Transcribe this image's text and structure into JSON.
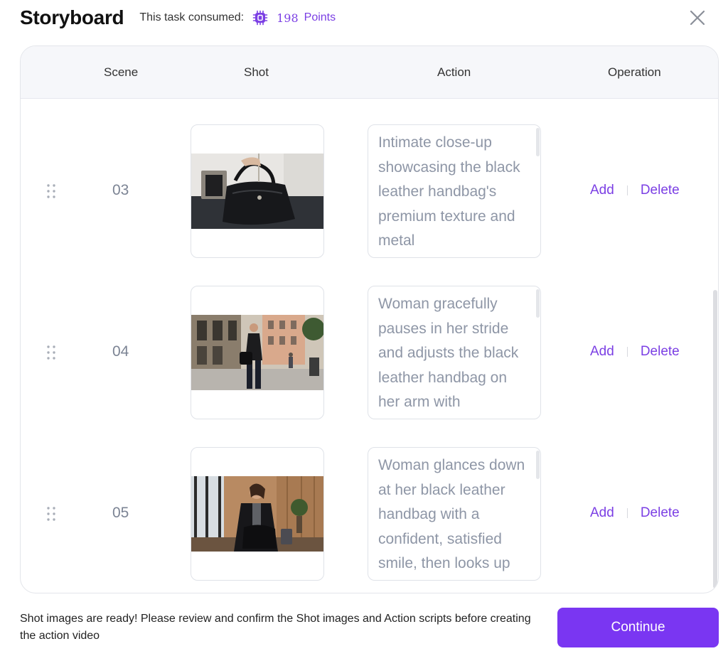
{
  "header": {
    "title": "Storyboard",
    "consumed_label": "This task consumed:",
    "points_value": "198",
    "points_unit": "Points"
  },
  "table": {
    "columns": {
      "scene": "Scene",
      "shot": "Shot",
      "action": "Action",
      "operation": "Operation"
    },
    "rows": [
      {
        "scene": "03",
        "action": "Intimate close-up showcasing the black leather handbag's premium texture and metal",
        "add": "Add",
        "delete": "Delete"
      },
      {
        "scene": "04",
        "action": "Woman gracefully pauses in her stride and adjusts the black leather handbag on her arm with",
        "add": "Add",
        "delete": "Delete"
      },
      {
        "scene": "05",
        "action": "Woman glances down at her black leather handbag with a confident, satisfied smile, then looks up",
        "add": "Add",
        "delete": "Delete"
      }
    ]
  },
  "footer": {
    "message": "Shot images are ready! Please review and confirm the Shot images and Action scripts before creating the action video",
    "continue_label": "Continue"
  },
  "colors": {
    "accent": "#7a36f2",
    "link": "#7b3fe4",
    "muted_text": "#8e96a6"
  },
  "icons": {
    "points": "chip-icon",
    "close": "close-icon",
    "drag": "drag-handle-icon"
  }
}
